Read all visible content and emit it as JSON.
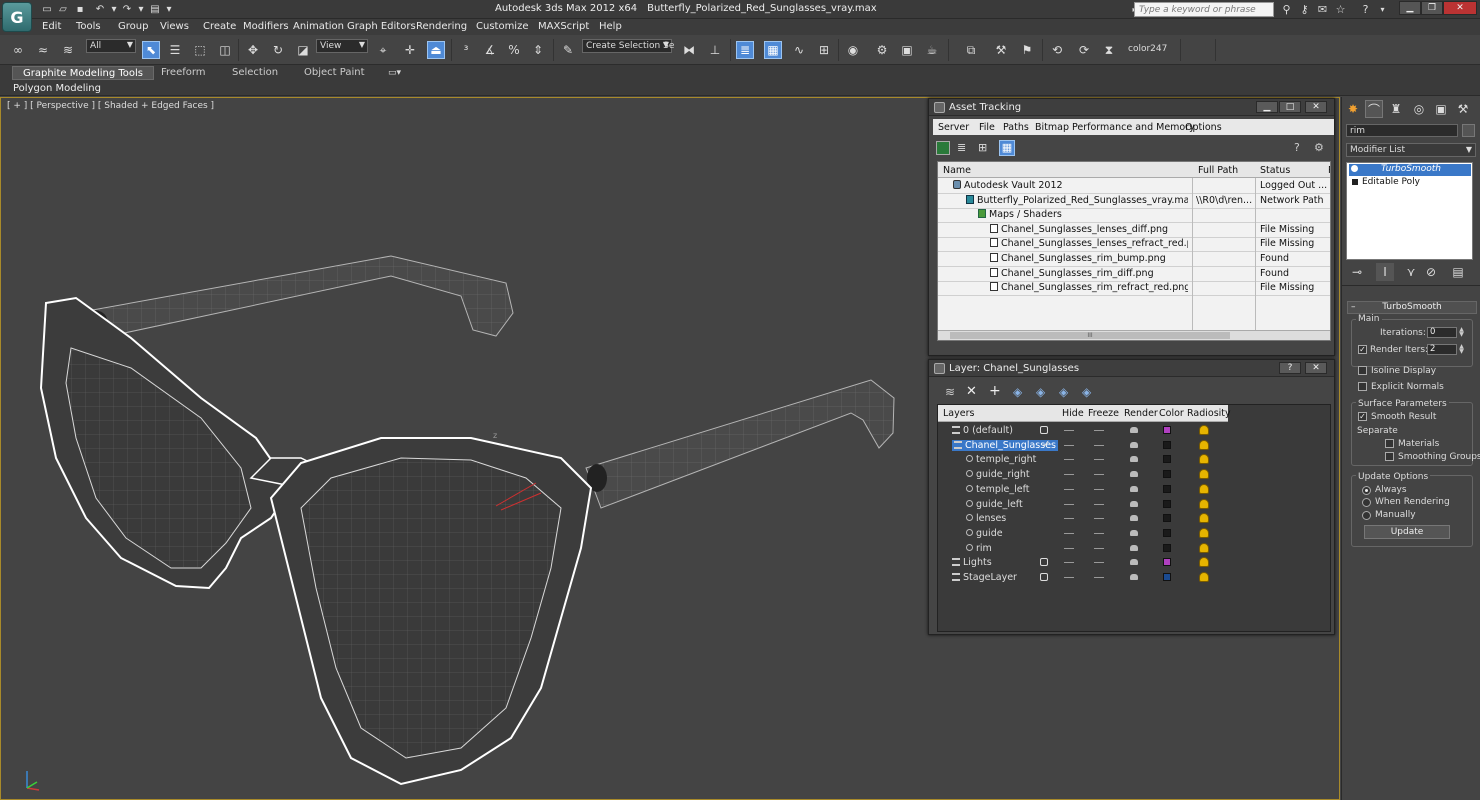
{
  "title": {
    "app": "Autodesk 3ds Max  2012 x64",
    "file": "Butterfly_Polarized_Red_Sunglasses_vray.max"
  },
  "app_logo": "G",
  "search": {
    "placeholder": "Type a keyword or phrase"
  },
  "menu": [
    "Edit",
    "Tools",
    "Group",
    "Views",
    "Create",
    "Modifiers",
    "Animation",
    "Graph Editors",
    "Rendering",
    "Customize",
    "MAXScript",
    "Help"
  ],
  "toolbar": {
    "filter_value": "All",
    "refcoord_value": "View",
    "selection_set_placeholder": "Create Selection Se",
    "color_label": "color247"
  },
  "ribbon": {
    "tabs": [
      "Graphite Modeling Tools",
      "Freeform",
      "Selection",
      "Object Paint"
    ],
    "sub_label": "Polygon Modeling"
  },
  "viewport": {
    "label": "[ + ] [ Perspective ] [ Shaded + Edged Faces ]",
    "axis_z": "z"
  },
  "asset_tracking": {
    "title": "Asset Tracking",
    "menu": [
      "Server",
      "File",
      "Paths",
      "Bitmap Performance and Memory",
      "Options"
    ],
    "columns": [
      "Name",
      "Full Path",
      "Status",
      "P"
    ],
    "rows": [
      {
        "name": "Autodesk Vault 2012",
        "path": "",
        "status": "Logged Out ...",
        "icon": "vault-icon"
      },
      {
        "name": "Butterfly_Polarized_Red_Sunglasses_vray.max",
        "path": "\\\\R0\\d\\ren...",
        "status": "Network Path",
        "icon": "max-file-icon"
      },
      {
        "name": "Maps / Shaders",
        "path": "",
        "status": "",
        "icon": "folder-icon"
      },
      {
        "name": "Chanel_Sunglasses_lenses_diff.png",
        "path": "",
        "status": "File Missing",
        "icon": "image-file-icon"
      },
      {
        "name": "Chanel_Sunglasses_lenses_refract_red.png",
        "path": "",
        "status": "File Missing",
        "icon": "image-file-icon"
      },
      {
        "name": "Chanel_Sunglasses_rim_bump.png",
        "path": "",
        "status": "Found",
        "icon": "image-file-icon"
      },
      {
        "name": "Chanel_Sunglasses_rim_diff.png",
        "path": "",
        "status": "Found",
        "icon": "image-file-icon"
      },
      {
        "name": "Chanel_Sunglasses_rim_refract_red.png",
        "path": "",
        "status": "File Missing",
        "icon": "image-file-icon"
      }
    ],
    "scroll_grip": "III"
  },
  "layer_dialog": {
    "title": "Layer: Chanel_Sunglasses",
    "help": "?",
    "columns": [
      "Layers",
      "Hide",
      "Freeze",
      "Render",
      "Color",
      "Radiosity"
    ],
    "rows": [
      {
        "name": "0 (default)",
        "kind": "layer",
        "color": "#b040c0",
        "hide_box": true,
        "selected": false
      },
      {
        "name": "Chanel_Sunglasses",
        "kind": "layer",
        "color": "#1a1a1a",
        "hide_box": false,
        "selected": true
      },
      {
        "name": "temple_right",
        "kind": "object",
        "color": "#1a1a1a",
        "hide_box": false,
        "selected": false
      },
      {
        "name": "guide_right",
        "kind": "object",
        "color": "#1a1a1a",
        "hide_box": false,
        "selected": false
      },
      {
        "name": "temple_left",
        "kind": "object",
        "color": "#1a1a1a",
        "hide_box": false,
        "selected": false
      },
      {
        "name": "guide_left",
        "kind": "object",
        "color": "#1a1a1a",
        "hide_box": false,
        "selected": false
      },
      {
        "name": "lenses",
        "kind": "object",
        "color": "#1a1a1a",
        "hide_box": false,
        "selected": false
      },
      {
        "name": "guide",
        "kind": "object",
        "color": "#1a1a1a",
        "hide_box": false,
        "selected": false
      },
      {
        "name": "rim",
        "kind": "object",
        "color": "#1a1a1a",
        "hide_box": false,
        "selected": false
      },
      {
        "name": "Lights",
        "kind": "layer",
        "color": "#b040c0",
        "hide_box": true,
        "selected": false
      },
      {
        "name": "StageLayer",
        "kind": "layer",
        "color": "#1a4a90",
        "hide_box": true,
        "selected": false
      }
    ]
  },
  "command_panel": {
    "object_name": "rim",
    "modifier_list": "Modifier List",
    "stack": [
      "TurboSmooth",
      "Editable Poly"
    ],
    "turbosmooth": {
      "title": "TurboSmooth",
      "main_label": "Main",
      "iterations_label": "Iterations:",
      "iterations": "0",
      "render_iters_label": "Render Iters:",
      "render_iters": "2",
      "isoline": "Isoline Display",
      "explicit": "Explicit Normals",
      "surface_label": "Surface Parameters",
      "smooth_result": "Smooth Result",
      "separate": "Separate",
      "materials": "Materials",
      "smoothing_groups": "Smoothing Groups",
      "update_options": "Update Options",
      "always": "Always",
      "when_rendering": "When Rendering",
      "manually": "Manually",
      "update_button": "Update"
    }
  },
  "colors": {
    "accent_blue": "#4f8ad6",
    "selection_blue": "#3a78c8",
    "viewport_border": "#a88a2a"
  }
}
